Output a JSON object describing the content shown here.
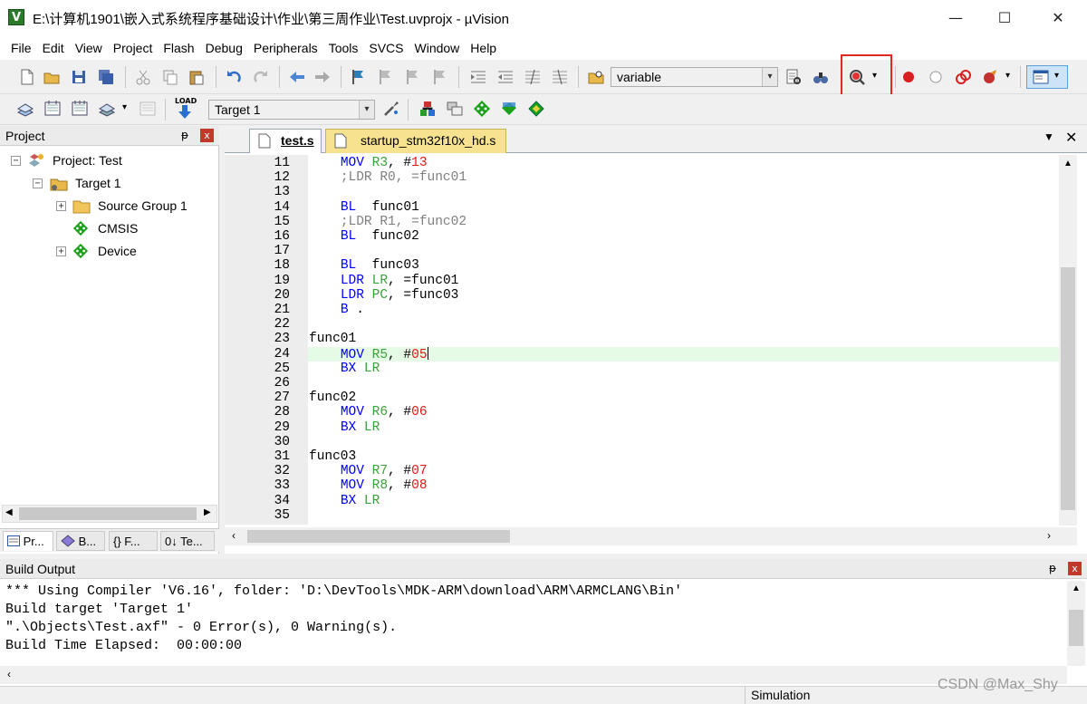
{
  "window": {
    "title": "E:\\计算机1901\\嵌入式系统程序基础设计\\作业\\第三周作业\\Test.uvprojx - µVision",
    "app_icon_letter": "V",
    "minimize": "—",
    "maximize": "☐",
    "close": "✕"
  },
  "menu": [
    {
      "label": "File"
    },
    {
      "label": "Edit"
    },
    {
      "label": "View"
    },
    {
      "label": "Project"
    },
    {
      "label": "Flash"
    },
    {
      "label": "Debug"
    },
    {
      "label": "Peripherals"
    },
    {
      "label": "Tools"
    },
    {
      "label": "SVCS"
    },
    {
      "label": "Window"
    },
    {
      "label": "Help"
    }
  ],
  "toolbar1": {
    "find_value": "variable"
  },
  "toolbar2": {
    "target_value": "Target 1",
    "load_label": "LOAD"
  },
  "project_panel": {
    "title": "Project",
    "pin": "ᵽ",
    "close": "x",
    "tree": [
      {
        "label": "Project: Test",
        "expander": "−"
      },
      {
        "label": "Target 1",
        "expander": "−"
      },
      {
        "label": "Source Group 1",
        "expander": "+"
      },
      {
        "label": "CMSIS",
        "expander": ""
      },
      {
        "label": "Device",
        "expander": "+"
      }
    ],
    "tabs": [
      {
        "label": "Pr..."
      },
      {
        "label": "B..."
      },
      {
        "label": "{} F..."
      },
      {
        "label": "0↓ Te..."
      }
    ]
  },
  "editor": {
    "tabs": [
      {
        "label": "test.s"
      },
      {
        "label": "startup_stm32f10x_hd.s"
      }
    ],
    "lines": [
      {
        "n": "11",
        "parts": [
          [
            "    ",
            ""
          ],
          [
            "MOV",
            "kw"
          ],
          [
            " ",
            ""
          ],
          [
            "R3",
            "reg"
          ],
          [
            ", #",
            ""
          ],
          [
            "13",
            "num"
          ]
        ]
      },
      {
        "n": "12",
        "parts": [
          [
            "    ",
            ""
          ],
          [
            ";LDR R0, =func01",
            "cmt"
          ]
        ]
      },
      {
        "n": "13",
        "parts": []
      },
      {
        "n": "14",
        "parts": [
          [
            "    ",
            ""
          ],
          [
            "BL",
            "kw"
          ],
          [
            "  func01",
            ""
          ]
        ]
      },
      {
        "n": "15",
        "parts": [
          [
            "    ",
            ""
          ],
          [
            ";LDR R1, =func02",
            "cmt"
          ]
        ]
      },
      {
        "n": "16",
        "parts": [
          [
            "    ",
            ""
          ],
          [
            "BL",
            "kw"
          ],
          [
            "  func02",
            ""
          ]
        ]
      },
      {
        "n": "17",
        "parts": []
      },
      {
        "n": "18",
        "parts": [
          [
            "    ",
            ""
          ],
          [
            "BL",
            "kw"
          ],
          [
            "  func03",
            ""
          ]
        ]
      },
      {
        "n": "19",
        "parts": [
          [
            "    ",
            ""
          ],
          [
            "LDR",
            "kw"
          ],
          [
            " ",
            ""
          ],
          [
            "LR",
            "reg"
          ],
          [
            ", =func01",
            ""
          ]
        ]
      },
      {
        "n": "20",
        "parts": [
          [
            "    ",
            ""
          ],
          [
            "LDR",
            "kw"
          ],
          [
            " ",
            ""
          ],
          [
            "PC",
            "reg"
          ],
          [
            ", =func03",
            ""
          ]
        ]
      },
      {
        "n": "21",
        "parts": [
          [
            "    ",
            ""
          ],
          [
            "B",
            "kw"
          ],
          [
            " .",
            ""
          ]
        ]
      },
      {
        "n": "22",
        "parts": []
      },
      {
        "n": "23",
        "parts": [
          [
            "func01",
            "lbl"
          ]
        ]
      },
      {
        "n": "24",
        "parts": [
          [
            "    ",
            ""
          ],
          [
            "MOV",
            "kw"
          ],
          [
            " ",
            ""
          ],
          [
            "R5",
            "reg"
          ],
          [
            ", #",
            ""
          ],
          [
            "05",
            "num"
          ]
        ],
        "current": true
      },
      {
        "n": "25",
        "parts": [
          [
            "    ",
            ""
          ],
          [
            "BX",
            "kw"
          ],
          [
            " ",
            ""
          ],
          [
            "LR",
            "reg"
          ]
        ]
      },
      {
        "n": "26",
        "parts": []
      },
      {
        "n": "27",
        "parts": [
          [
            "func02",
            "lbl"
          ]
        ]
      },
      {
        "n": "28",
        "parts": [
          [
            "    ",
            ""
          ],
          [
            "MOV",
            "kw"
          ],
          [
            " ",
            ""
          ],
          [
            "R6",
            "reg"
          ],
          [
            ", #",
            ""
          ],
          [
            "06",
            "num"
          ]
        ]
      },
      {
        "n": "29",
        "parts": [
          [
            "    ",
            ""
          ],
          [
            "BX",
            "kw"
          ],
          [
            " ",
            ""
          ],
          [
            "LR",
            "reg"
          ]
        ]
      },
      {
        "n": "30",
        "parts": []
      },
      {
        "n": "31",
        "parts": [
          [
            "func03",
            "lbl"
          ]
        ]
      },
      {
        "n": "32",
        "parts": [
          [
            "    ",
            ""
          ],
          [
            "MOV",
            "kw"
          ],
          [
            " ",
            ""
          ],
          [
            "R7",
            "reg"
          ],
          [
            ", #",
            ""
          ],
          [
            "07",
            "num"
          ]
        ]
      },
      {
        "n": "33",
        "parts": [
          [
            "    ",
            ""
          ],
          [
            "MOV",
            "kw"
          ],
          [
            " ",
            ""
          ],
          [
            "R8",
            "reg"
          ],
          [
            ", #",
            ""
          ],
          [
            "08",
            "num"
          ]
        ]
      },
      {
        "n": "34",
        "parts": [
          [
            "    ",
            ""
          ],
          [
            "BX",
            "kw"
          ],
          [
            " ",
            ""
          ],
          [
            "LR",
            "reg"
          ]
        ]
      },
      {
        "n": "35",
        "parts": []
      }
    ]
  },
  "build_output": {
    "title": "Build Output",
    "pin": "ᵽ",
    "close": "x",
    "lines": [
      "*** Using Compiler 'V6.16', folder: 'D:\\DevTools\\MDK-ARM\\download\\ARM\\ARMCLANG\\Bin'",
      "Build target 'Target 1'",
      "\".\\Objects\\Test.axf\" - 0 Error(s), 0 Warning(s).",
      "Build Time Elapsed:  00:00:00"
    ]
  },
  "status": {
    "mode": "Simulation",
    "watermark": "CSDN @Max_Shy"
  }
}
